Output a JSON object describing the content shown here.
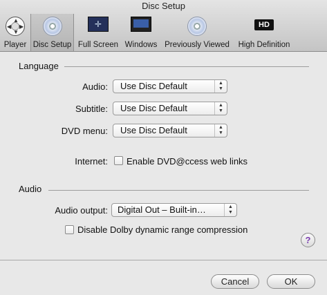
{
  "window": {
    "title": "Disc Setup"
  },
  "toolbar": {
    "items": [
      {
        "label": "Player",
        "icon": "player-icon"
      },
      {
        "label": "Disc Setup",
        "icon": "disc-icon",
        "selected": true
      },
      {
        "label": "Full Screen",
        "icon": "full-screen-icon"
      },
      {
        "label": "Windows",
        "icon": "windows-icon"
      },
      {
        "label": "Previously Viewed",
        "icon": "disc-icon"
      },
      {
        "label": "High Definition",
        "icon": "hd-icon",
        "icon_text": "HD"
      }
    ]
  },
  "language": {
    "section_label": "Language",
    "audio_label": "Audio:",
    "audio_value": "Use Disc Default",
    "subtitle_label": "Subtitle:",
    "subtitle_value": "Use Disc Default",
    "dvd_menu_label": "DVD menu:",
    "dvd_menu_value": "Use Disc Default",
    "internet_label": "Internet:",
    "dvd_access_label": "Enable DVD@ccess web links",
    "dvd_access_checked": false
  },
  "audio": {
    "section_label": "Audio",
    "output_label": "Audio output:",
    "output_value": "Digital Out – Built-in…",
    "dolby_label": "Disable Dolby dynamic range compression",
    "dolby_checked": false
  },
  "help": {
    "symbol": "?"
  },
  "buttons": {
    "cancel_label": "Cancel",
    "ok_label": "OK"
  },
  "colors": {
    "help_accent": "#7b3fb0"
  }
}
